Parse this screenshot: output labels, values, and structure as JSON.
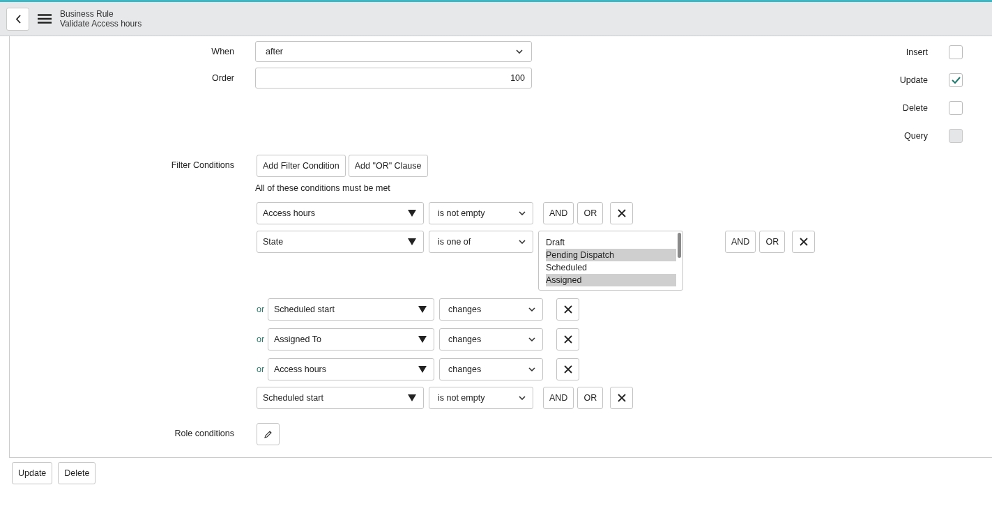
{
  "header": {
    "breadcrumb": "Business Rule",
    "title": "Validate Access hours"
  },
  "fields": [
    {
      "label": "When",
      "kind": "select",
      "value": "after"
    },
    {
      "label": "Order",
      "kind": "number",
      "value": "100"
    }
  ],
  "actions": [
    {
      "label": "Insert",
      "checked": false,
      "disabled": false
    },
    {
      "label": "Update",
      "checked": true,
      "disabled": false
    },
    {
      "label": "Delete",
      "checked": false,
      "disabled": false
    },
    {
      "label": "Query",
      "checked": false,
      "disabled": true
    }
  ],
  "filter": {
    "label": "Filter Conditions",
    "buttons": [
      "Add Filter Condition",
      "Add \"OR\" Clause"
    ],
    "note": "All of these conditions must be met",
    "conditions": [
      {
        "field": "Access hours",
        "operator": "is not empty",
        "connectors": [
          "AND",
          "OR"
        ]
      },
      {
        "field": "State",
        "operator": "is one of",
        "options": [
          {
            "label": "Draft",
            "selected": false
          },
          {
            "label": "Pending Dispatch",
            "selected": true
          },
          {
            "label": "Scheduled",
            "selected": false
          },
          {
            "label": "Assigned",
            "selected": true
          }
        ],
        "connectors": [
          "AND",
          "OR"
        ],
        "or_conditions": [
          {
            "connector": "or",
            "field": "Scheduled start",
            "operator": "changes"
          },
          {
            "connector": "or",
            "field": "Assigned To",
            "operator": "changes"
          },
          {
            "connector": "or",
            "field": "Access hours",
            "operator": "changes"
          }
        ]
      },
      {
        "field": "Scheduled start",
        "operator": "is not empty",
        "connectors": [
          "AND",
          "OR"
        ]
      }
    ]
  },
  "role_conditions": {
    "label": "Role conditions"
  },
  "buttons": [
    "Update",
    "Delete"
  ]
}
